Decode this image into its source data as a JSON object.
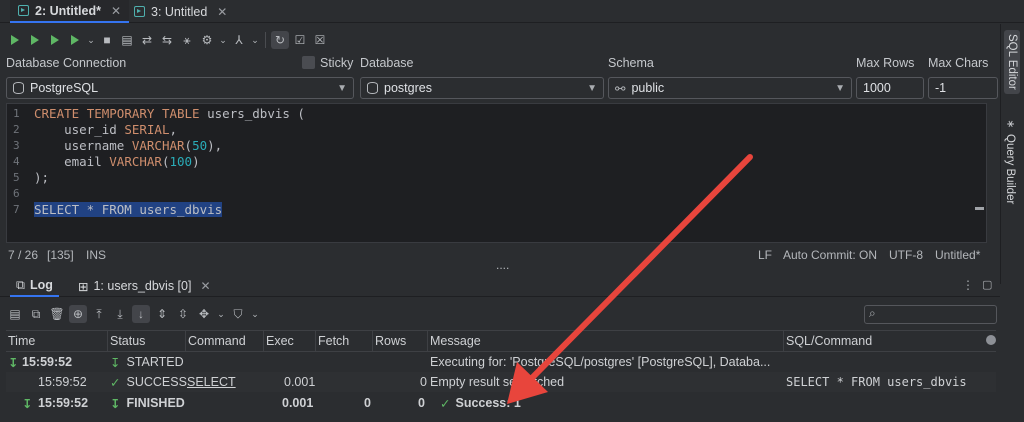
{
  "tabs": [
    {
      "label": "2: Untitled*",
      "active": true
    },
    {
      "label": "3: Untitled",
      "active": false
    }
  ],
  "connection": {
    "db_connection_label": "Database Connection",
    "sticky_label": "Sticky",
    "database_label": "Database",
    "schema_label": "Schema",
    "max_rows_label": "Max Rows",
    "max_chars_label": "Max Chars",
    "db_connection_value": "PostgreSQL",
    "database_value": "postgres",
    "schema_value": "public",
    "max_rows_value": "1000",
    "max_chars_value": "-1"
  },
  "editor": {
    "line_numbers": [
      "1",
      "2",
      "3",
      "4",
      "5",
      "6",
      "7"
    ],
    "lines": [
      "CREATE TEMPORARY TABLE users_dbvis (",
      "    user_id SERIAL,",
      "    username VARCHAR(50),",
      "    email VARCHAR(100)",
      ");",
      "",
      "SELECT * FROM users_dbvis"
    ]
  },
  "status": {
    "position": "7 / 26",
    "offset": "[135]",
    "mode": "INS",
    "dots": "....",
    "line_ending": "LF",
    "auto_commit": "Auto Commit: ON",
    "encoding": "UTF-8",
    "file": "Untitled*"
  },
  "sidebar": {
    "sql_editor": "SQL Editor",
    "query_builder": "Query Builder"
  },
  "bottom_tabs": [
    {
      "label": "Log",
      "active": true
    },
    {
      "label": "1: users_dbvis [0]",
      "active": false
    }
  ],
  "log_table": {
    "headers": [
      "Time",
      "Status",
      "Command",
      "Exec",
      "Fetch",
      "Rows",
      "Message",
      "SQL/Command"
    ],
    "rows": [
      {
        "time": "15:59:52",
        "status": "STARTED",
        "command": "",
        "exec": "",
        "fetch": "",
        "rows": "",
        "message": "Executing for: 'PostgreSQL/postgres' [PostgreSQL], Databa...",
        "sql": ""
      },
      {
        "time": "15:59:52",
        "status": "SUCCESS",
        "command": "SELECT",
        "exec": "0.001",
        "fetch": "",
        "rows": "0",
        "message": "Empty result set fetched",
        "sql": "SELECT * FROM users_dbvis"
      },
      {
        "time": "15:59:52",
        "status": "FINISHED",
        "command": "",
        "exec": "0.001",
        "fetch": "0",
        "rows": "0",
        "message": "Success: 1",
        "sql": ""
      }
    ]
  },
  "colors": {
    "accent": "#3574f0",
    "success": "#5fb865",
    "annotation_arrow": "#e8453c"
  }
}
